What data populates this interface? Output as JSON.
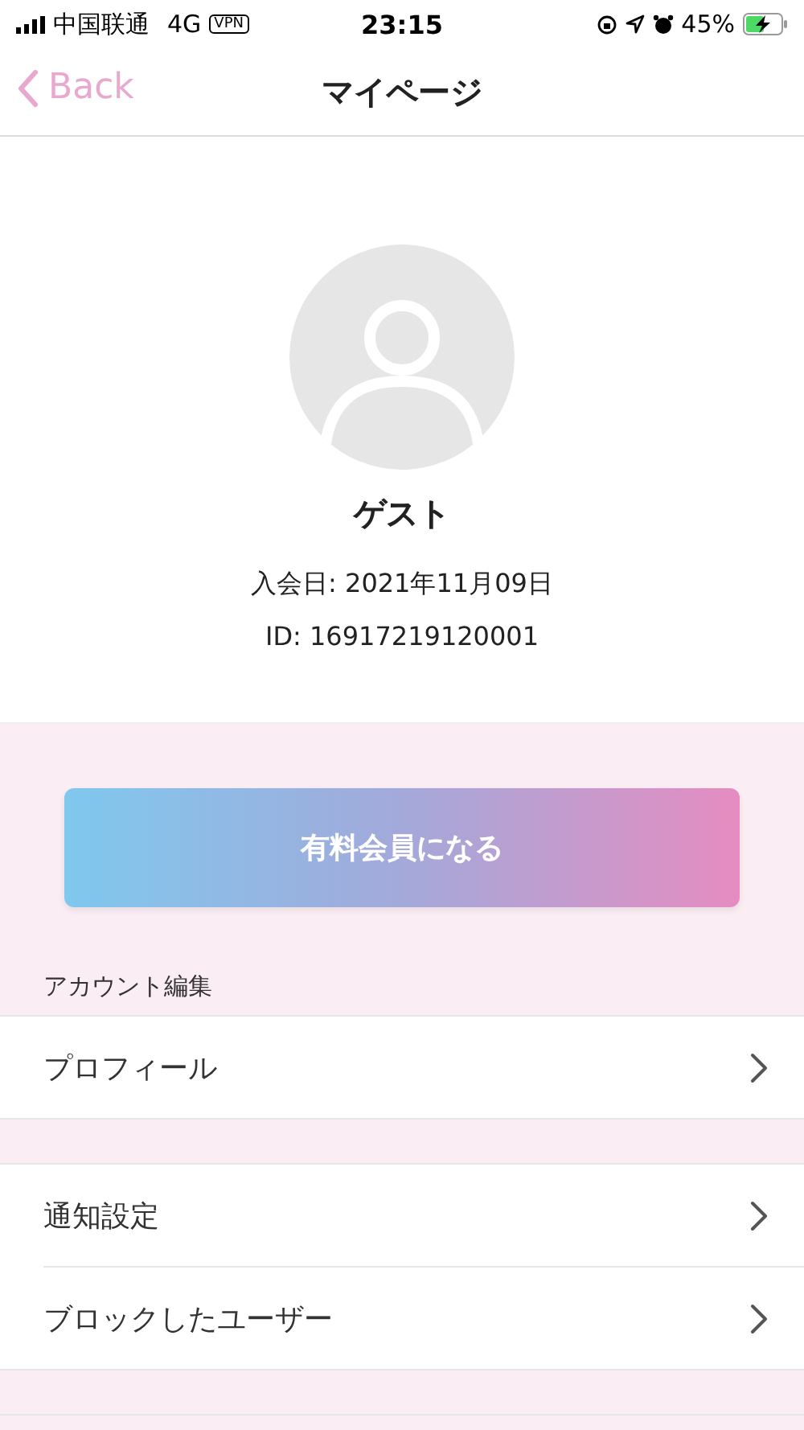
{
  "status_bar": {
    "carrier": "中国联通",
    "network": "4G",
    "vpn": "VPN",
    "time": "23:15",
    "battery": "45%"
  },
  "nav": {
    "back": "Back",
    "title": "マイページ"
  },
  "profile": {
    "name": "ゲスト",
    "joined": "入会日: 2021年11月09日",
    "id": "ID: 16917219120001"
  },
  "upgrade_button": "有料会員になる",
  "groups": [
    {
      "header": "アカウント編集",
      "items": [
        "プロフィール"
      ]
    },
    {
      "items": [
        "通知設定",
        "ブロックしたユーザー"
      ]
    }
  ]
}
